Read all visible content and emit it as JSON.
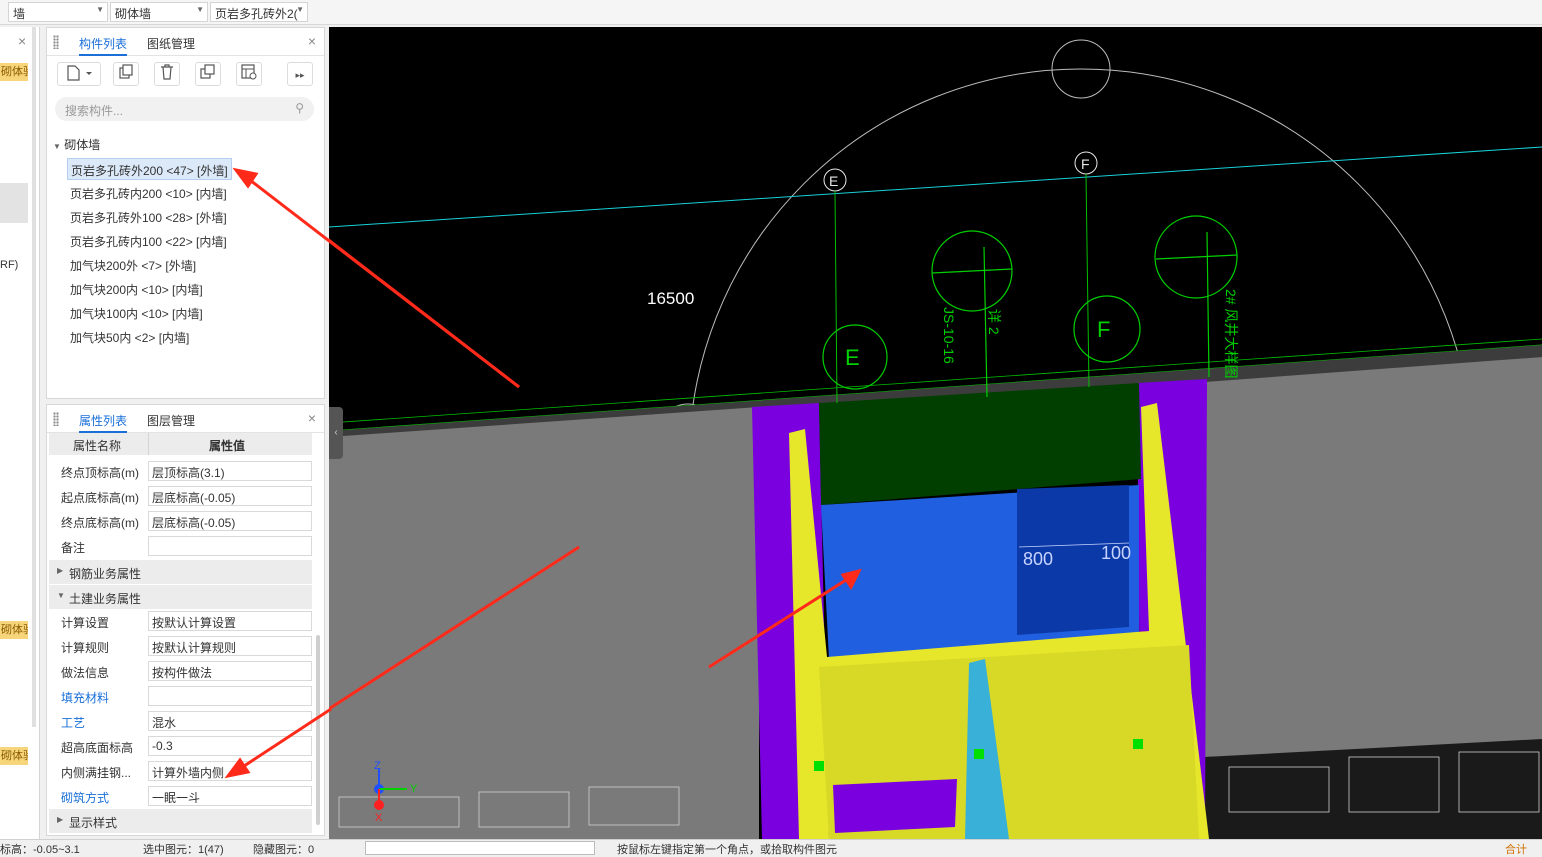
{
  "topbar": {
    "combo1": "墙",
    "combo2": "砌体墙",
    "combo3": "页岩多孔砖外2("
  },
  "left_strip": {
    "tag1": "砌体验",
    "tag2": "砌体验",
    "tag3": "砌体验",
    "text_rf": "RF)"
  },
  "component_panel": {
    "tabs": [
      "构件列表",
      "图纸管理"
    ],
    "search_placeholder": "搜索构件...",
    "root": "砌体墙",
    "items": [
      "页岩多孔砖外200 <47> [外墙]",
      "页岩多孔砖内200 <10> [内墙]",
      "页岩多孔砖外100 <28> [外墙]",
      "页岩多孔砖内100 <22> [内墙]",
      "加气块200外 <7> [外墙]",
      "加气块200内 <10> [内墙]",
      "加气块100内 <10> [内墙]",
      "加气块50内 <2> [内墙]"
    ],
    "selected_index": 0
  },
  "property_panel": {
    "tabs": [
      "属性列表",
      "图层管理"
    ],
    "header": {
      "name": "属性名称",
      "value": "属性值"
    },
    "rows_top": [
      {
        "name": "终点顶标高(m)",
        "value": "层顶标高(3.1)"
      },
      {
        "name": "起点底标高(m)",
        "value": "层底标高(-0.05)"
      },
      {
        "name": "终点底标高(m)",
        "value": "层底标高(-0.05)"
      },
      {
        "name": "备注",
        "value": ""
      }
    ],
    "group1": "钢筋业务属性",
    "group2": "土建业务属性",
    "rows_civil": [
      {
        "name": "计算设置",
        "value": "按默认计算设置",
        "blue": false
      },
      {
        "name": "计算规则",
        "value": "按默认计算规则",
        "blue": false
      },
      {
        "name": "做法信息",
        "value": "按构件做法",
        "blue": false
      },
      {
        "name": "填充材料",
        "value": "",
        "blue": true
      },
      {
        "name": "工艺",
        "value": "混水",
        "blue": true
      },
      {
        "name": "超高底面标高",
        "value": "-0.3",
        "blue": false
      },
      {
        "name": "内侧满挂钢...",
        "value": "计算外墙内侧",
        "blue": false
      },
      {
        "name": "砌筑方式",
        "value": "一眠一斗",
        "blue": true
      }
    ],
    "group3": "显示样式"
  },
  "viewport": {
    "label_16500": "16500",
    "axis_E": "E",
    "axis_F": "F",
    "dim_800": "800",
    "dim_100": "100",
    "cad_text1": "JS-10-16",
    "cad_text2": "2# 风井大样图",
    "cad_text3": "详 2",
    "axis_z": "Z",
    "axis_y": "Y",
    "axis_x": "X",
    "colors": {
      "wall_grey": "#7a7a7a",
      "purple": "#7a00e0",
      "yellow": "#e6e62a",
      "blue": "#1f5fe0",
      "dark_green": "#003f00",
      "cad_green": "#00d000",
      "cyan_line": "#18d0d8",
      "arrow_red": "#ff2a1a"
    }
  },
  "statusbar": {
    "elev": "标高：-0.05~3.1",
    "selected": "选中图元：1(47)",
    "hidden": "隐藏图元：0",
    "hint": "按鼠标左键指定第一个角点，或拾取构件图元",
    "right": "合计"
  }
}
